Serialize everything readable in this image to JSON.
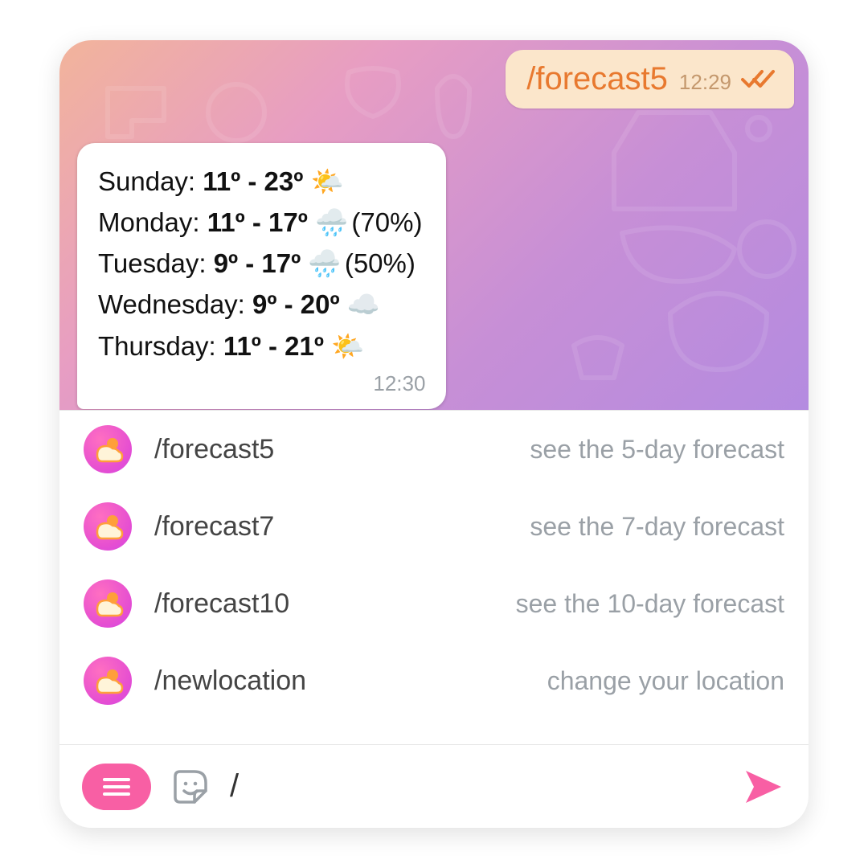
{
  "messages": {
    "outgoing": {
      "text": "/forecast5",
      "time": "12:29"
    },
    "incoming": {
      "forecast": [
        {
          "day": "Sunday:",
          "temps": "11º - 23º",
          "icon": "sun-cloud",
          "pct": ""
        },
        {
          "day": "Monday:",
          "temps": "11º - 17º",
          "icon": "rain-cloud",
          "pct": "(70%)"
        },
        {
          "day": "Tuesday:",
          "temps": "9º - 17º",
          "icon": "rain-cloud",
          "pct": "(50%)"
        },
        {
          "day": "Wednesday:",
          "temps": "9º - 20º",
          "icon": "cloud",
          "pct": ""
        },
        {
          "day": "Thursday:",
          "temps": "11º - 21º",
          "icon": "sun-cloud",
          "pct": ""
        }
      ],
      "time": "12:30"
    }
  },
  "commands": [
    {
      "name": "/forecast5",
      "desc": "see the 5-day forecast"
    },
    {
      "name": "/forecast7",
      "desc": "see the 7-day forecast"
    },
    {
      "name": "/forecast10",
      "desc": "see the 10-day forecast"
    },
    {
      "name": "/newlocation",
      "desc": "change your location"
    }
  ],
  "compose": {
    "value": "/"
  },
  "icons": {
    "weather_map": {
      "sun-cloud": "🌤️",
      "rain-cloud": "🌧️",
      "cloud": "☁️"
    }
  },
  "colors": {
    "accent_pink": "#f85fa4",
    "outgoing_text": "#e8792f"
  }
}
